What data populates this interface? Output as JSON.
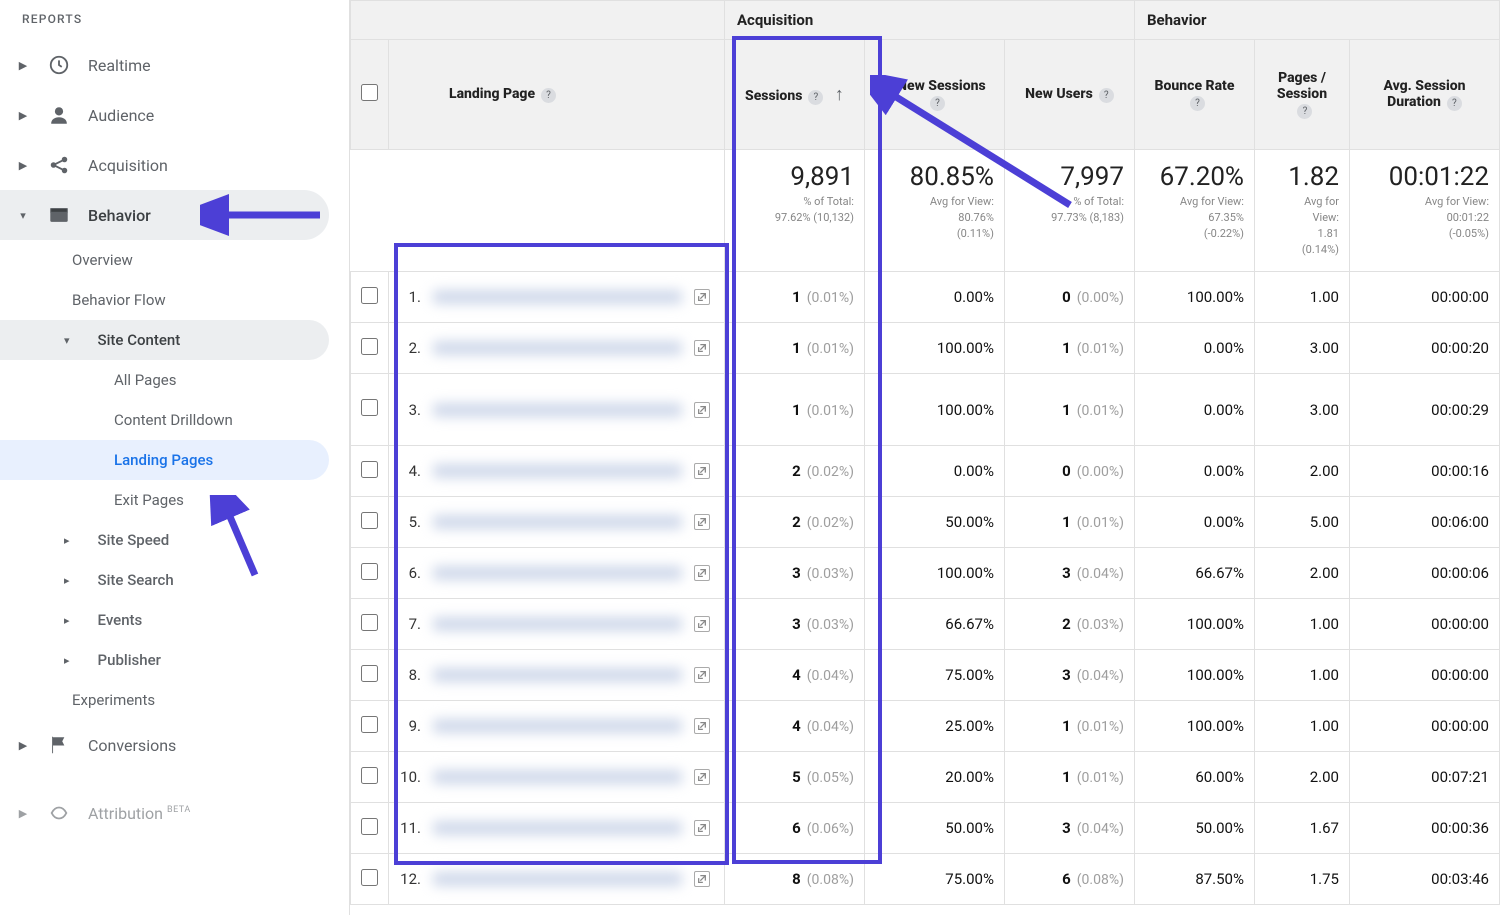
{
  "sidebar": {
    "header": "REPORTS",
    "items": [
      {
        "label": "Realtime",
        "icon": "clock"
      },
      {
        "label": "Audience",
        "icon": "person"
      },
      {
        "label": "Acquisition",
        "icon": "share"
      },
      {
        "label": "Behavior",
        "icon": "window",
        "expanded": true
      },
      {
        "label": "Conversions",
        "icon": "flag"
      }
    ],
    "behavior_children": [
      {
        "label": "Overview"
      },
      {
        "label": "Behavior Flow"
      },
      {
        "label": "Site Content",
        "expanded": true,
        "children": [
          {
            "label": "All Pages"
          },
          {
            "label": "Content Drilldown"
          },
          {
            "label": "Landing Pages",
            "active": true
          },
          {
            "label": "Exit Pages"
          }
        ]
      },
      {
        "label": "Site Speed",
        "caret": true
      },
      {
        "label": "Site Search",
        "caret": true
      },
      {
        "label": "Events",
        "caret": true
      },
      {
        "label": "Publisher",
        "caret": true
      },
      {
        "label": "Experiments"
      }
    ],
    "attribution_label": "Attribution",
    "beta": "BETA"
  },
  "table": {
    "group_headers": {
      "acquisition": "Acquisition",
      "behavior": "Behavior"
    },
    "columns": {
      "landing": "Landing Page",
      "sessions": "Sessions",
      "new_pct": "% New Sessions",
      "new_users": "New Users",
      "bounce": "Bounce Rate",
      "pps": "Pages / Session",
      "duration": "Avg. Session Duration"
    },
    "summary": {
      "sessions": {
        "big": "9,891",
        "l1": "% of Total:",
        "l2": "97.62% (10,132)"
      },
      "new_pct": {
        "big": "80.85%",
        "l1": "Avg for View:",
        "l2": "80.76%",
        "l3": "(0.11%)"
      },
      "new_users": {
        "big": "7,997",
        "l1": "% of Total:",
        "l2": "97.73% (8,183)"
      },
      "bounce": {
        "big": "67.20%",
        "l1": "Avg for View:",
        "l2": "67.35%",
        "l3": "(-0.22%)"
      },
      "pps": {
        "big": "1.82",
        "l1": "Avg for",
        "l2": "View:",
        "l3": "1.81",
        "l4": "(0.14%)"
      },
      "duration": {
        "big": "00:01:22",
        "l1": "Avg for View:",
        "l2": "00:01:22",
        "l3": "(-0.05%)"
      }
    },
    "rows": [
      {
        "n": "1.",
        "sessions": "1",
        "sessions_pct": "(0.01%)",
        "new_pct": "0.00%",
        "new_users": "0",
        "new_users_pct": "(0.00%)",
        "bounce": "100.00%",
        "pps": "1.00",
        "dur": "00:00:00"
      },
      {
        "n": "2.",
        "sessions": "1",
        "sessions_pct": "(0.01%)",
        "new_pct": "100.00%",
        "new_users": "1",
        "new_users_pct": "(0.01%)",
        "bounce": "0.00%",
        "pps": "3.00",
        "dur": "00:00:20"
      },
      {
        "n": "3.",
        "sessions": "1",
        "sessions_pct": "(0.01%)",
        "new_pct": "100.00%",
        "new_users": "1",
        "new_users_pct": "(0.01%)",
        "bounce": "0.00%",
        "pps": "3.00",
        "dur": "00:00:29",
        "tall": true
      },
      {
        "n": "4.",
        "sessions": "2",
        "sessions_pct": "(0.02%)",
        "new_pct": "0.00%",
        "new_users": "0",
        "new_users_pct": "(0.00%)",
        "bounce": "0.00%",
        "pps": "2.00",
        "dur": "00:00:16"
      },
      {
        "n": "5.",
        "sessions": "2",
        "sessions_pct": "(0.02%)",
        "new_pct": "50.00%",
        "new_users": "1",
        "new_users_pct": "(0.01%)",
        "bounce": "0.00%",
        "pps": "5.00",
        "dur": "00:06:00"
      },
      {
        "n": "6.",
        "sessions": "3",
        "sessions_pct": "(0.03%)",
        "new_pct": "100.00%",
        "new_users": "3",
        "new_users_pct": "(0.04%)",
        "bounce": "66.67%",
        "pps": "2.00",
        "dur": "00:00:06"
      },
      {
        "n": "7.",
        "sessions": "3",
        "sessions_pct": "(0.03%)",
        "new_pct": "66.67%",
        "new_users": "2",
        "new_users_pct": "(0.03%)",
        "bounce": "100.00%",
        "pps": "1.00",
        "dur": "00:00:00"
      },
      {
        "n": "8.",
        "sessions": "4",
        "sessions_pct": "(0.04%)",
        "new_pct": "75.00%",
        "new_users": "3",
        "new_users_pct": "(0.04%)",
        "bounce": "100.00%",
        "pps": "1.00",
        "dur": "00:00:00"
      },
      {
        "n": "9.",
        "sessions": "4",
        "sessions_pct": "(0.04%)",
        "new_pct": "25.00%",
        "new_users": "1",
        "new_users_pct": "(0.01%)",
        "bounce": "100.00%",
        "pps": "1.00",
        "dur": "00:00:00"
      },
      {
        "n": "10.",
        "sessions": "5",
        "sessions_pct": "(0.05%)",
        "new_pct": "20.00%",
        "new_users": "1",
        "new_users_pct": "(0.01%)",
        "bounce": "60.00%",
        "pps": "2.00",
        "dur": "00:07:21"
      },
      {
        "n": "11.",
        "sessions": "6",
        "sessions_pct": "(0.06%)",
        "new_pct": "50.00%",
        "new_users": "3",
        "new_users_pct": "(0.04%)",
        "bounce": "50.00%",
        "pps": "1.67",
        "dur": "00:00:36"
      },
      {
        "n": "12.",
        "sessions": "8",
        "sessions_pct": "(0.08%)",
        "new_pct": "75.00%",
        "new_users": "6",
        "new_users_pct": "(0.08%)",
        "bounce": "87.50%",
        "pps": "1.75",
        "dur": "00:03:46"
      }
    ]
  }
}
